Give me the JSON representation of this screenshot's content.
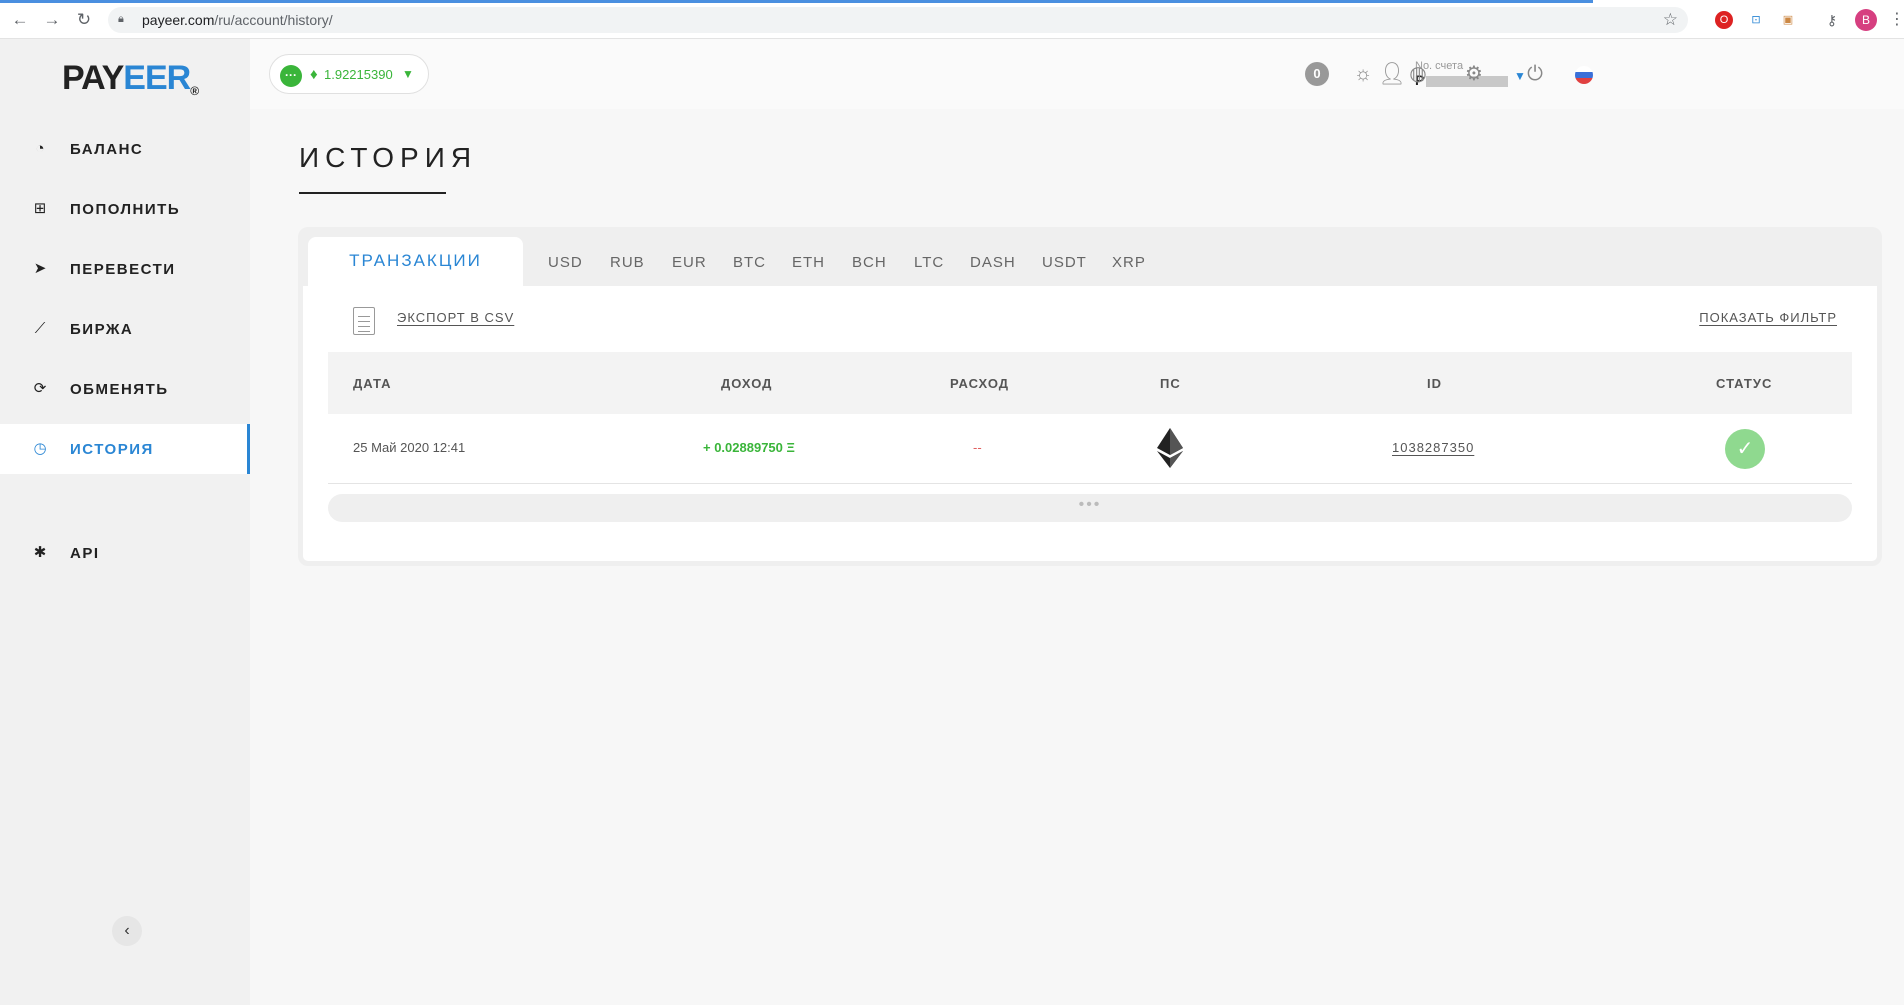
{
  "browser": {
    "url_host": "payeer.com",
    "url_path": "/ru/account/history/",
    "profile_letter": "B"
  },
  "logo": {
    "part1": "PAY",
    "part2": "EER",
    "mark": "®"
  },
  "sidebar": {
    "items": [
      {
        "label": "БАЛАНС",
        "icon": "gauge-icon",
        "glyph": "◔"
      },
      {
        "label": "ПОПОЛНИТЬ",
        "icon": "plus-square-icon",
        "glyph": "⊞"
      },
      {
        "label": "ПЕРЕВЕСТИ",
        "icon": "paper-plane-icon",
        "glyph": "➤"
      },
      {
        "label": "БИРЖА",
        "icon": "chart-icon",
        "glyph": "⟋"
      },
      {
        "label": "ОБМЕНЯТЬ",
        "icon": "exchange-icon",
        "glyph": "⟳"
      },
      {
        "label": "ИСТОРИЯ",
        "icon": "clock-icon",
        "glyph": "◷"
      },
      {
        "label": "API",
        "icon": "gears-icon",
        "glyph": "✱"
      }
    ],
    "active_index": 5,
    "collapse_glyph": "‹"
  },
  "topbar": {
    "balance_dots": "···",
    "balance_currency_glyph": "♦",
    "balance_amount": "1.92215390",
    "notification_count": "0",
    "account_label": "No. счета",
    "account_value": "P"
  },
  "page": {
    "title": "ИСТОРИЯ"
  },
  "tabs": {
    "main": "ТРАНЗАКЦИИ",
    "currencies": [
      "USD",
      "RUB",
      "EUR",
      "BTC",
      "ETH",
      "BCH",
      "LTC",
      "DASH",
      "USDT",
      "XRP"
    ]
  },
  "actions": {
    "export": "ЭКСПОРТ В CSV",
    "filter": "ПОКАЗАТЬ ФИЛЬТР"
  },
  "table": {
    "columns": [
      "ДАТА",
      "ДОХОД",
      "РАСХОД",
      "ПС",
      "ID",
      "СТАТУС"
    ],
    "rows": [
      {
        "date": "25 Май 2020 12:41",
        "income": "+ 0.02889750 Ξ",
        "expense": "--",
        "ps_icon": "ethereum-icon",
        "id": "1038287350",
        "status": "success"
      }
    ],
    "more": "•••"
  },
  "colors": {
    "accent": "#2a86d4",
    "positive": "#3ab53a",
    "negative": "#e06060",
    "status_ok": "#8fd98f"
  }
}
